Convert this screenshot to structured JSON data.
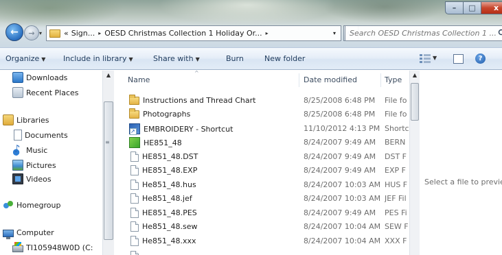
{
  "window": {
    "controls": {
      "minimize": "–",
      "maximize": "□",
      "close": "x"
    }
  },
  "address_bar": {
    "prefix": "«",
    "segments": [
      "Sign...",
      "OESD Christmas Collection 1 Holiday Or..."
    ],
    "separator": "▸",
    "dropdown": "▾",
    "refresh_icon": "refresh-icon"
  },
  "search": {
    "placeholder": "Search OESD Christmas Collection 1 ..."
  },
  "toolbar": {
    "organize": "Organize",
    "include_in_library": "Include in library",
    "share_with": "Share with",
    "burn": "Burn",
    "new_folder": "New folder"
  },
  "nav_pane": {
    "items": [
      {
        "label": "Downloads",
        "icon": "downloads-icon"
      },
      {
        "label": "Recent Places",
        "icon": "recent-places-icon"
      },
      {
        "label": "Libraries",
        "icon": "libraries-icon"
      },
      {
        "label": "Documents",
        "icon": "documents-icon"
      },
      {
        "label": "Music",
        "icon": "music-icon"
      },
      {
        "label": "Pictures",
        "icon": "pictures-icon"
      },
      {
        "label": "Videos",
        "icon": "videos-icon"
      },
      {
        "label": "Homegroup",
        "icon": "homegroup-icon"
      },
      {
        "label": "Computer",
        "icon": "computer-icon"
      },
      {
        "label": "TI105948W0D (C:",
        "icon": "drive-icon"
      }
    ]
  },
  "file_list": {
    "columns": {
      "name": "Name",
      "date_modified": "Date modified",
      "type": "Type"
    },
    "rows": [
      {
        "name": "Instructions and Thread Chart",
        "date": "8/25/2008 6:48 PM",
        "type": "File fo",
        "icon": "folder-icon"
      },
      {
        "name": "Photographs",
        "date": "8/25/2008 6:48 PM",
        "type": "File fo",
        "icon": "folder-icon"
      },
      {
        "name": "EMBROIDERY - Shortcut",
        "date": "11/10/2012 4:13 PM",
        "type": "Shortc",
        "icon": "shortcut-icon"
      },
      {
        "name": "HE851_48",
        "date": "8/24/2007 9:49 AM",
        "type": "BERN",
        "icon": "bernina-file-icon"
      },
      {
        "name": "HE851_48.DST",
        "date": "8/24/2007 9:49 AM",
        "type": "DST F",
        "icon": "file-icon"
      },
      {
        "name": "HE851_48.EXP",
        "date": "8/24/2007 9:49 AM",
        "type": "EXP F",
        "icon": "file-icon"
      },
      {
        "name": "He851_48.hus",
        "date": "8/24/2007 10:03 AM",
        "type": "HUS F",
        "icon": "file-icon"
      },
      {
        "name": "He851_48.jef",
        "date": "8/24/2007 10:03 AM",
        "type": "JEF Fil",
        "icon": "file-icon"
      },
      {
        "name": "HE851_48.PES",
        "date": "8/24/2007 9:49 AM",
        "type": "PES Fi",
        "icon": "file-icon"
      },
      {
        "name": "He851_48.sew",
        "date": "8/24/2007 10:04 AM",
        "type": "SEW F",
        "icon": "file-icon"
      },
      {
        "name": "He851_48.xxx",
        "date": "8/24/2007 10:04 AM",
        "type": "XXX F",
        "icon": "file-icon"
      }
    ]
  },
  "preview_pane": {
    "message": "Select a file to preview"
  }
}
